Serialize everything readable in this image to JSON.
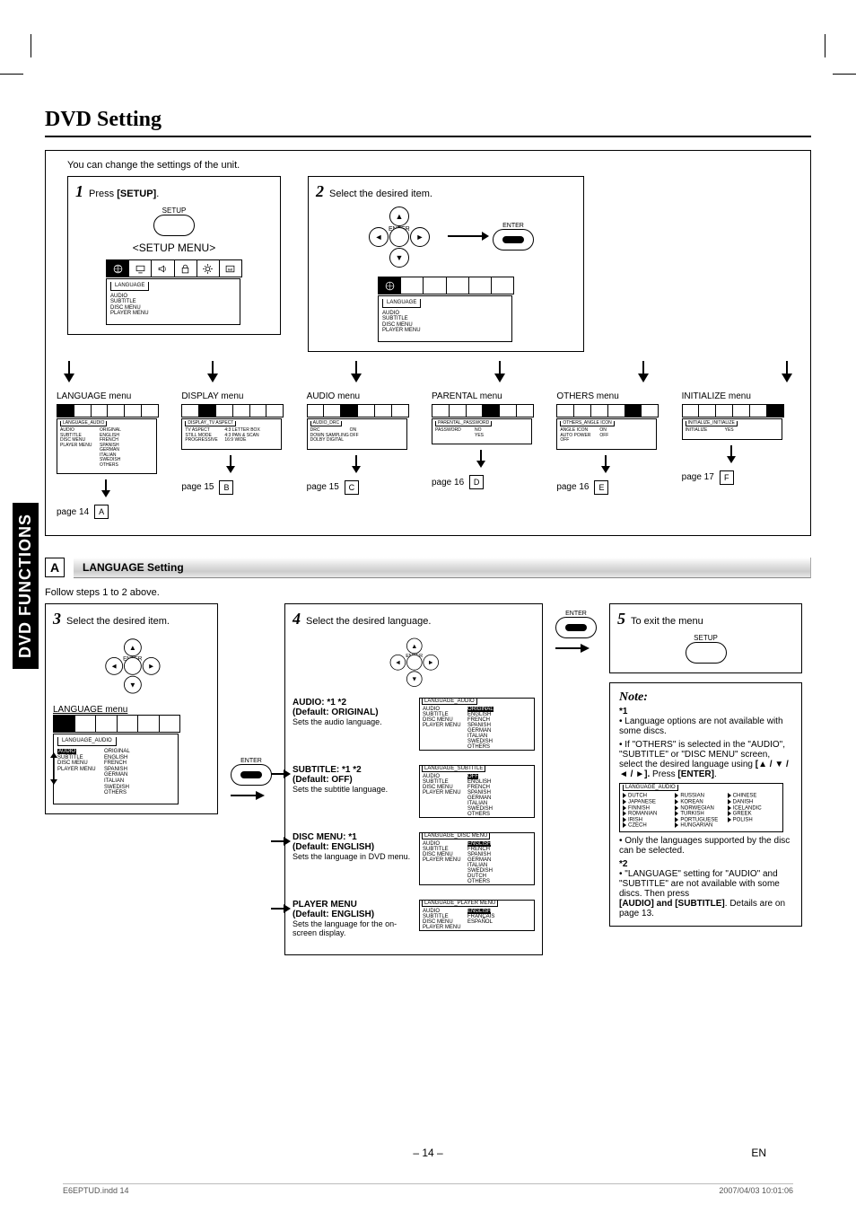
{
  "page_title": "DVD Setting",
  "side_tab": "DVD FUNCTIONS",
  "intro": "You can change the settings of the unit.",
  "step1": {
    "num": "1",
    "text": "Press ",
    "bold": "[SETUP]",
    "btn_label": "SETUP",
    "heading": "<SETUP MENU>"
  },
  "step2": {
    "num": "2",
    "text": "Select the desired item.",
    "enter_lbl": "ENTER"
  },
  "menu_categories": [
    "LANGUAGE",
    "AUDIO",
    "SUBTITLE",
    "DISC MENU",
    "PLAYER MENU"
  ],
  "menus": [
    {
      "title": "LANGUAGE menu",
      "tab": "LANGUAGE_AUDIO",
      "rows": [
        [
          "AUDIO",
          "ORIGINAL"
        ],
        [
          "SUBTITLE",
          "ENGLISH"
        ],
        [
          "DISC MENU",
          "FRENCH"
        ],
        [
          "PLAYER MENU",
          "SPANISH"
        ],
        [
          "",
          "GERMAN"
        ],
        [
          "",
          "ITALIAN"
        ],
        [
          "",
          "SWEDISH"
        ],
        [
          "",
          "OTHERS"
        ]
      ],
      "sel_col1": "AUDIO",
      "page": "page 14",
      "ref": "A"
    },
    {
      "title": "DISPLAY menu",
      "tab": "DISPLAY_TV ASPECT",
      "rows": [
        [
          "TV ASPECT",
          "4:3 LETTER BOX"
        ],
        [
          "STILL MODE",
          "4:3 PAN & SCAN"
        ],
        [
          "PROGRESSIVE",
          "16:9 WIDE"
        ]
      ],
      "sel_col1": "TV ASPECT",
      "page": "page 15",
      "ref": "B"
    },
    {
      "title": "AUDIO menu",
      "tab": "AUDIO_DRC",
      "rows": [
        [
          "DRC",
          "ON"
        ],
        [
          "DOWN SAMPLING",
          "OFF"
        ],
        [
          "DOLBY DIGITAL",
          ""
        ]
      ],
      "sel_col1": "DRC",
      "page": "page 15",
      "ref": "C"
    },
    {
      "title": "PARENTAL menu",
      "tab": "PARENTAL_PASSWORD",
      "rows": [
        [
          "PASSWORD",
          "NO"
        ],
        [
          "",
          "YES"
        ]
      ],
      "sel_col1": "PASSWORD",
      "page": "page 16",
      "ref": "D"
    },
    {
      "title": "OTHERS menu",
      "tab": "OTHERS_ANGLE ICON",
      "rows": [
        [
          "ANGLE ICON",
          "ON"
        ],
        [
          "AUTO POWER OFF",
          "OFF"
        ]
      ],
      "sel_col1": "ANGLE ICON",
      "page": "page 16",
      "ref": "E"
    },
    {
      "title": "INITIALIZE menu",
      "tab": "INITIALIZE_INITIALIZE",
      "rows": [
        [
          "INITIALIZE",
          "YES"
        ]
      ],
      "sel_col1": "INITIALIZE",
      "page": "page 17",
      "ref": "F"
    }
  ],
  "sectionA": {
    "letter": "A",
    "title": "LANGUAGE Setting",
    "follow": "Follow steps 1 to 2 above."
  },
  "step3": {
    "num": "3",
    "text": "Select the desired item.",
    "heading": "LANGUAGE menu",
    "enter_lbl": "ENTER"
  },
  "step3_menu": {
    "tab": "LANGUAGE_AUDIO",
    "rows": [
      [
        "AUDIO",
        "ORIGINAL"
      ],
      [
        "SUBTITLE",
        "ENGLISH"
      ],
      [
        "DISC MENU",
        "FRENCH"
      ],
      [
        "PLAYER MENU",
        "SPANISH"
      ],
      [
        "",
        "GERMAN"
      ],
      [
        "",
        "ITALIAN"
      ],
      [
        "",
        "SWEDISH"
      ],
      [
        "",
        "OTHERS"
      ]
    ]
  },
  "step4": {
    "num": "4",
    "text": "Select the desired language.",
    "enter_lbl": "ENTER",
    "items": [
      {
        "title": "AUDIO: *1 *2",
        "def": "(Default: ORIGINAL)",
        "desc": "Sets the audio language.",
        "panel": {
          "tab": "LANGUAGE_AUDIO",
          "rows": [
            [
              "AUDIO",
              "ORIGINAL"
            ],
            [
              "SUBTITLE",
              "ENGLISH"
            ],
            [
              "DISC MENU",
              "FRENCH"
            ],
            [
              "PLAYER MENU",
              "SPANISH"
            ],
            [
              "",
              "GERMAN"
            ],
            [
              "",
              "ITALIAN"
            ],
            [
              "",
              "SWEDISH"
            ],
            [
              "",
              "OTHERS"
            ]
          ],
          "hl": "ORIGINAL"
        }
      },
      {
        "title": "SUBTITLE: *1 *2",
        "def": "(Default: OFF)",
        "desc": "Sets the subtitle language.",
        "panel": {
          "tab": "LANGUAGE_SUBTITLE",
          "rows": [
            [
              "AUDIO",
              "OFF"
            ],
            [
              "SUBTITLE",
              "ENGLISH"
            ],
            [
              "DISC MENU",
              "FRENCH"
            ],
            [
              "PLAYER MENU",
              "SPANISH"
            ],
            [
              "",
              "GERMAN"
            ],
            [
              "",
              "ITALIAN"
            ],
            [
              "",
              "SWEDISH"
            ],
            [
              "",
              "OTHERS"
            ]
          ],
          "hl": "OFF"
        }
      },
      {
        "title": "DISC MENU: *1",
        "def": "(Default: ENGLISH)",
        "desc": "Sets the language in DVD menu.",
        "panel": {
          "tab": "LANGUAGE_DISC MENU",
          "rows": [
            [
              "AUDIO",
              "ENGLISH"
            ],
            [
              "SUBTITLE",
              "FRENCH"
            ],
            [
              "DISC MENU",
              "SPANISH"
            ],
            [
              "PLAYER MENU",
              "GERMAN"
            ],
            [
              "",
              "ITALIAN"
            ],
            [
              "",
              "SWEDISH"
            ],
            [
              "",
              "DUTCH"
            ],
            [
              "",
              "OTHERS"
            ]
          ],
          "hl": "ENGLISH"
        }
      },
      {
        "title": "PLAYER MENU",
        "def": "(Default: ENGLISH)",
        "desc": "Sets the language for the on-screen display.",
        "panel": {
          "tab": "LANGUAGE_PLAYER MENU",
          "rows": [
            [
              "AUDIO",
              "ENGLISH"
            ],
            [
              "SUBTITLE",
              "FRANÇAIS"
            ],
            [
              "DISC MENU",
              "ESPAÑOL"
            ],
            [
              "PLAYER MENU",
              ""
            ]
          ],
          "hl": "ENGLISH"
        }
      }
    ]
  },
  "step5": {
    "num": "5",
    "text": "To exit the menu",
    "btn_label": "SETUP",
    "enter_lbl": "ENTER"
  },
  "note": {
    "title": "Note:",
    "s1": "*1",
    "b1": "• Language options are not available with some discs.",
    "b2_a": "• If \"OTHERS\" is selected in the \"AUDIO\", \"SUBTITLE\" or \"DISC MENU\" screen, select the desired language using",
    "b2_b": "[▲ / ▼ / ◄ / ►].",
    "b2_c": " Press ",
    "b2_d": "[ENTER]",
    "others_panel": {
      "tab": "LANGUAGE_AUDIO",
      "sel": "DUTCH",
      "items": [
        "DUTCH",
        "RUSSIAN",
        "CHINESE",
        "JAPANESE",
        "KOREAN",
        "DANISH",
        "FINNISH",
        "NORWEGIAN",
        "ICELANDIC",
        "ROMANIAN",
        "TURKISH",
        "GREEK",
        "IRISH",
        "PORTUGUESE",
        "POLISH",
        "CZECH",
        "HUNGARIAN"
      ]
    },
    "b3": "• Only the languages supported by the disc can be selected.",
    "s2": "*2",
    "b4": "• \"LANGUAGE\" setting for \"AUDIO\" and \"SUBTITLE\" are not available with some discs. Then press",
    "b4_bold": " [AUDIO] and [SUBTITLE]",
    "b4_tail": ". Details are on page 13."
  },
  "footer": {
    "page": "– 14 –",
    "lang": "EN",
    "job_l": "E6EPTUD.indd   14",
    "job_r": "2007/04/03   10:01:06"
  }
}
